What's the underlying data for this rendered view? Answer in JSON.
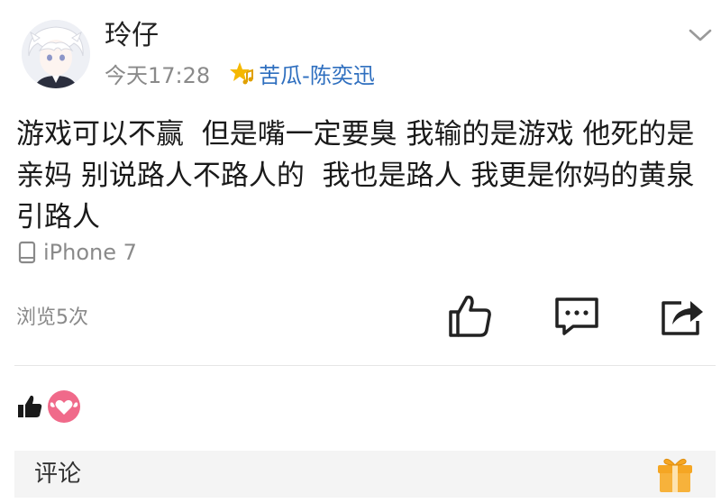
{
  "post": {
    "username": "玲仔",
    "time": "今天17:28",
    "source": "苦瓜-陈奕迅",
    "text": "游戏可以不赢  但是嘴一定要臭 我输的是游戏 他死的是亲妈 别说路人不路人的  我也是路人 我更是你妈的黄泉引路人",
    "device": "iPhone 7",
    "views": "浏览5次"
  },
  "comment_bar": {
    "label": "评论"
  },
  "icons": {
    "menu": "chevron-down-icon",
    "source": "star-music-icon",
    "device": "phone-icon",
    "like": "thumbs-up-icon",
    "comment": "comment-bubble-icon",
    "share": "share-icon",
    "reaction_like": "thumbs-up-icon",
    "reaction_love": "heart-wings-icon",
    "gift": "gift-icon"
  },
  "colors": {
    "source_link": "#2f6fbf",
    "muted_text": "#8a8a8a",
    "reaction_love": "#f06a8a",
    "gift": "#f5a623"
  }
}
